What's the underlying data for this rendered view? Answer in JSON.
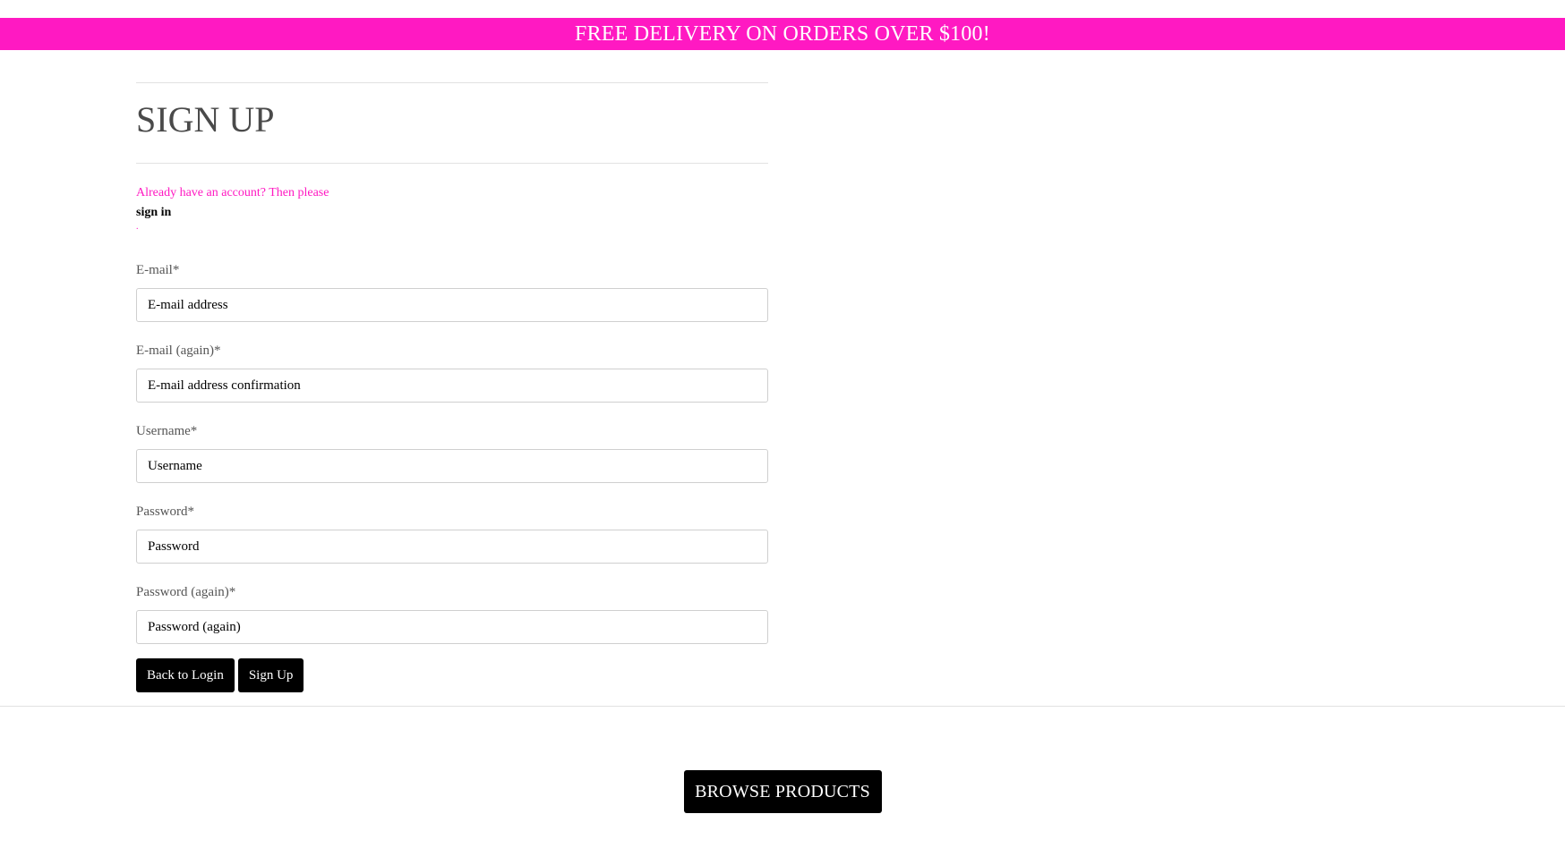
{
  "promo": {
    "text": "FREE DELIVERY ON ORDERS OVER $100!",
    "background_color": "#ff19c2"
  },
  "form": {
    "title": "SIGN UP",
    "signin_prompt": "Already have an account? Then please",
    "signin_link": "sign in",
    "signin_suffix": ".",
    "fields": [
      {
        "label": "E-mail*",
        "placeholder": "E-mail address"
      },
      {
        "label": "E-mail (again)*",
        "placeholder": "E-mail address confirmation"
      },
      {
        "label": "Username*",
        "placeholder": "Username"
      },
      {
        "label": "Password*",
        "placeholder": "Password"
      },
      {
        "label": "Password (again)*",
        "placeholder": "Password (again)"
      }
    ],
    "back_button": "Back to Login",
    "signup_button": "Sign Up"
  },
  "footer": {
    "browse_button": "BROWSE PRODUCTS"
  },
  "colors": {
    "accent": "#ff19c2",
    "button": "#000000"
  }
}
